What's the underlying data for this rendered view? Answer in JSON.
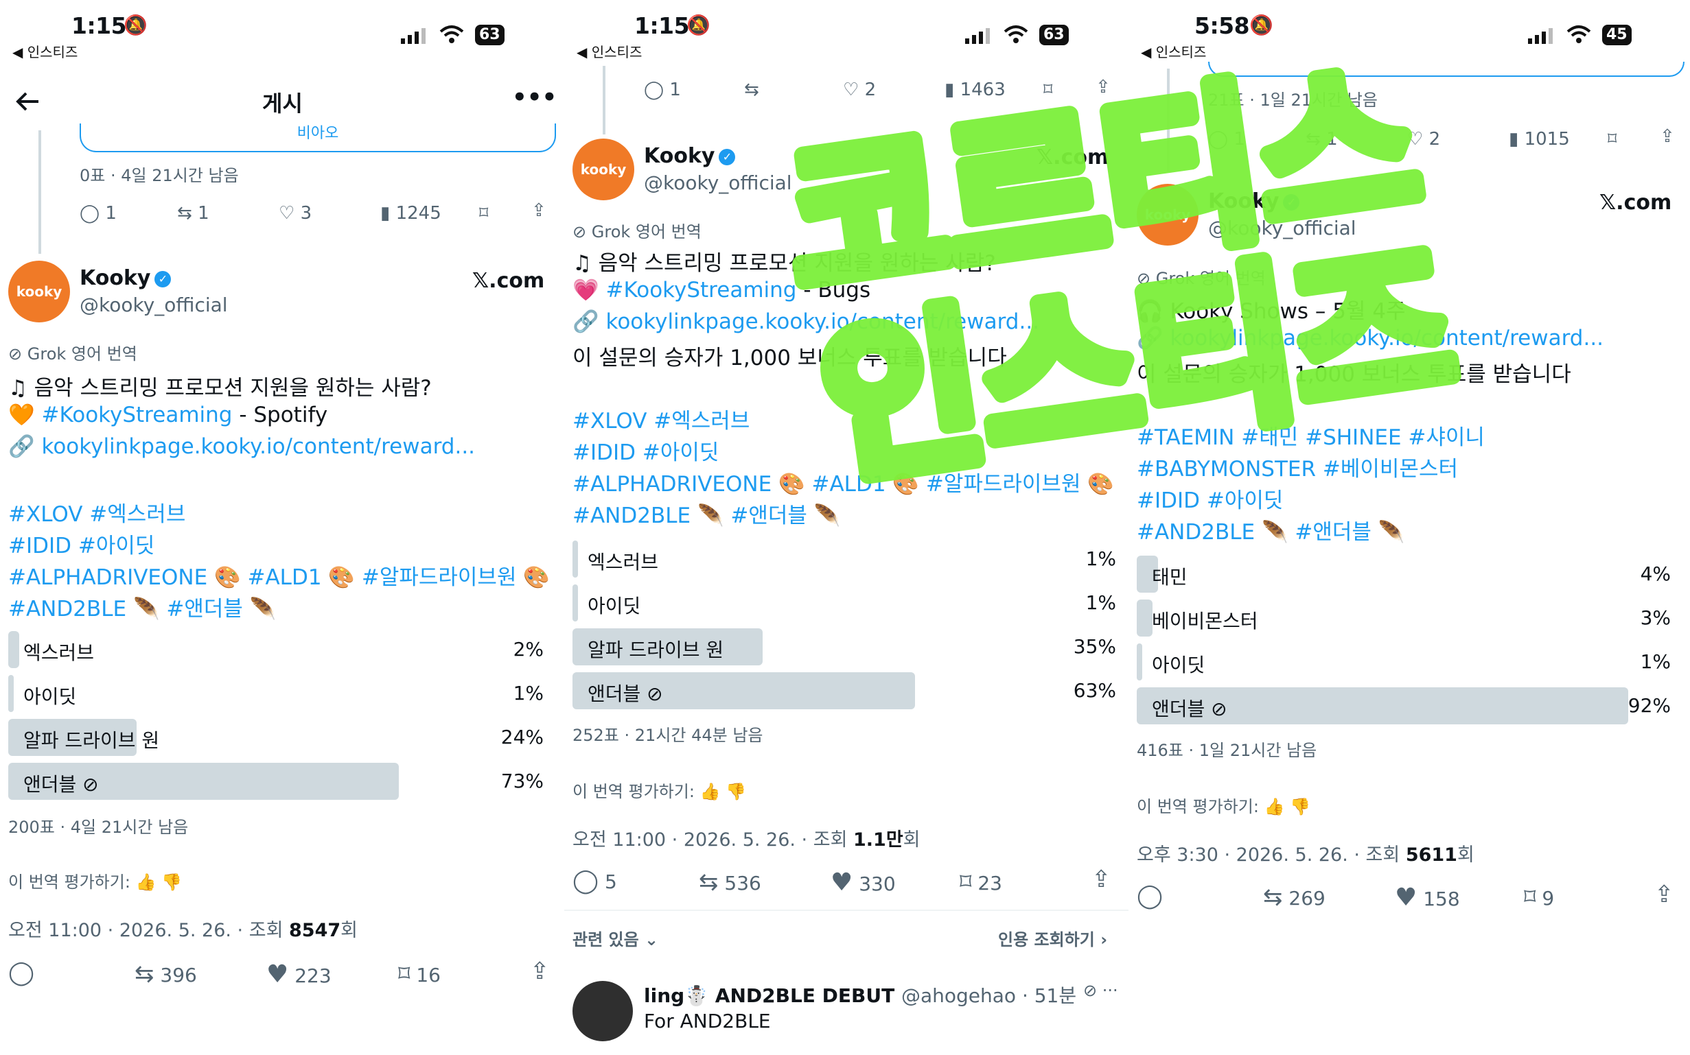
{
  "panels": [
    {
      "status": {
        "time": "1:15",
        "back_app": "◀ 인스티즈",
        "battery": "63"
      },
      "header": {
        "title": "게시"
      },
      "prev_tweet": {
        "poll_button": "비아오",
        "poll_meta": "0표 · 4일 21시간 남음",
        "replies": "1",
        "retweets": "1",
        "likes": "3",
        "views": "1245"
      },
      "author": {
        "avatar": "kooky",
        "name": "Kooky",
        "handle": "@kooky_official",
        "source": "𝕏.com"
      },
      "translation_label": "Grok 영어 번역",
      "lines": [
        "♫  음악 스트리밍 프로모션 지원을 원하는 사람?"
      ],
      "streaming_line": {
        "emoji": "🧡",
        "tag": "#KookyStreaming",
        "rest": " - Spotify"
      },
      "link_line": {
        "emoji": "🔗",
        "url": "kookylinkpage.kooky.io/content/reward..."
      },
      "hashtags": [
        "#XLOV #엑스러브",
        "#IDID #아이딧",
        "#ALPHADRIVEONE 🎨 #ALD1 🎨 #알파드라이브원 🎨",
        "#AND2BLE 🪶 #앤더블 🪶"
      ],
      "poll": [
        {
          "label": "엑스러브",
          "pct": "2%",
          "value": 2
        },
        {
          "label": "아이딧",
          "pct": "1%",
          "value": 1
        },
        {
          "label": "알파 드라이브 원",
          "pct": "24%",
          "value": 24
        },
        {
          "label": "앤더블 ⊘",
          "pct": "73%",
          "value": 73
        }
      ],
      "poll_meta": "200표 · 4일 21시간 남음",
      "rate": "이 번역 평가하기:",
      "timestamp": "오전 11:00 · 2026. 5. 26. · 조회 ",
      "views_bold": "8547",
      "views_unit": "회",
      "actions": {
        "replies": "",
        "retweets": "396",
        "likes": "223",
        "bookmarks": "16"
      }
    },
    {
      "status": {
        "time": "1:15",
        "back_app": "◀ 인스티즈",
        "battery": "63"
      },
      "prev_tweet": {
        "replies": "1",
        "retweets": "",
        "likes": "2",
        "views": "1463"
      },
      "author": {
        "avatar": "kooky",
        "name": "Kooky",
        "handle": "@kooky_official",
        "source": "𝕏.com"
      },
      "translation_label": "Grok 영어 번역",
      "lines": [
        "♫  음악 스트리밍 프로모션 지원을 원하는 사람?"
      ],
      "streaming_line": {
        "emoji": "💗",
        "tag": "#KookyStreaming",
        "rest": " - Bugs"
      },
      "link_line": {
        "emoji": "🔗",
        "url": "kookylinkpage.kooky.io/content/reward..."
      },
      "extra_line": "이 설문의 승자가 1,000 보너스 투표를 받습니다",
      "hashtags": [
        "#XLOV #엑스러브",
        "#IDID #아이딧",
        "#ALPHADRIVEONE 🎨 #ALD1 🎨 #알파드라이브원 🎨",
        "#AND2BLE 🪶 #앤더블 🪶"
      ],
      "poll": [
        {
          "label": "엑스러브",
          "pct": "1%",
          "value": 1
        },
        {
          "label": "아이딧",
          "pct": "1%",
          "value": 1
        },
        {
          "label": "알파 드라이브 원",
          "pct": "35%",
          "value": 35
        },
        {
          "label": "앤더블 ⊘",
          "pct": "63%",
          "value": 63
        }
      ],
      "poll_meta": "252표 · 21시간 44분 남음",
      "rate": "이 번역 평가하기:",
      "timestamp": "오전 11:00 · 2026. 5. 26. · 조회 ",
      "views_bold": "1.1만",
      "views_unit": "회",
      "actions": {
        "replies": "5",
        "retweets": "536",
        "likes": "330",
        "bookmarks": "23"
      },
      "related": "관련 있음",
      "quote_views": "인용 조회하기",
      "reply": {
        "name": "ling☃️ AND2BLE DEBUT",
        "handle": "@ahogehao · 51분",
        "text": "For AND2BLE"
      }
    },
    {
      "status": {
        "time": "5:58",
        "back_app": "◀ 인스티즈",
        "battery": "45"
      },
      "prev_tweet": {
        "poll_meta": "21표 · 1일 21시간 남음",
        "replies": "1",
        "retweets": "1",
        "likes": "2",
        "views": "1015"
      },
      "author": {
        "avatar": "kooky",
        "name": "Kooky",
        "handle": "@kooky_official",
        "source": "𝕏.com"
      },
      "translation_label": "Grok 영어 번역",
      "lines": [
        "🎧 Kooky Shows – 5월 4주"
      ],
      "link_line": {
        "emoji": "🔗",
        "url": "kookylinkpage.kooky.io/content/reward..."
      },
      "extra_line": "이 설문의 승자가 1,000 보너스 투표를 받습니다",
      "hashtags": [
        "#TAEMIN #태민 #SHINEE #샤이니",
        "#BABYMONSTER #베이비몬스터",
        "#IDID #아이딧",
        "#AND2BLE 🪶 #앤더블 🪶"
      ],
      "poll": [
        {
          "label": "태민",
          "pct": "4%",
          "value": 4
        },
        {
          "label": "베이비몬스터",
          "pct": "3%",
          "value": 3
        },
        {
          "label": "아이딧",
          "pct": "1%",
          "value": 1
        },
        {
          "label": "앤더블 ⊘",
          "pct": "92%",
          "value": 92
        }
      ],
      "poll_meta": "416표 · 1일 21시간 남음",
      "rate": "이 번역 평가하기:",
      "timestamp": "오후 3:30 · 2026. 5. 26. · 조회 ",
      "views_bold": "5611",
      "views_unit": "회",
      "actions": {
        "replies": "",
        "retweets": "269",
        "likes": "158",
        "bookmarks": "9"
      }
    }
  ],
  "watermark": {
    "line1": "코르티스",
    "line2": "인스티즈",
    "color": "#7cf03a"
  }
}
